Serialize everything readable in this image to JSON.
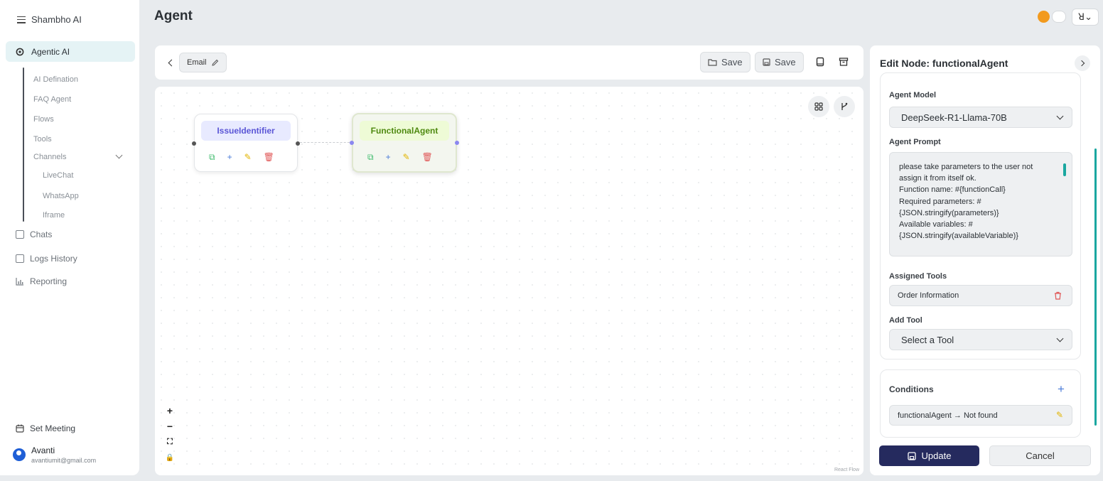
{
  "sidebar": {
    "brand": "Shambho AI",
    "active_item": "Agentic AI",
    "sub_items": [
      "AI Defination",
      "FAQ Agent",
      "Flows",
      "Tools",
      "Channels"
    ],
    "channel_items": [
      "LiveChat",
      "WhatsApp",
      "Iframe"
    ],
    "nav_items": [
      "Chats",
      "Logs History",
      "Reporting"
    ],
    "set_meeting": "Set Meeting",
    "user": {
      "name": "Avanti",
      "email": "avantiumit@gmail.com"
    }
  },
  "header": {
    "title": "Agent",
    "user_glyph": "ꓤ⌄"
  },
  "toolbar": {
    "tag": "Email",
    "save_draft": "Save",
    "save": "Save"
  },
  "canvas": {
    "nodes": [
      {
        "label": "IssueIdentifier"
      },
      {
        "label": "FunctionalAgent"
      }
    ],
    "zoom_in": "+",
    "zoom_out": "−",
    "fit": "⛶",
    "lock": "🔒",
    "attribution": "React Flow"
  },
  "panel": {
    "title": "Edit Node: functionalAgent",
    "agent_model_label": "Agent Model",
    "agent_model_value": "DeepSeek-R1-Llama-70B",
    "agent_prompt_label": "Agent Prompt",
    "agent_prompt": "please take parameters to the user not assign it from itself ok.\nFunction name: #{functionCall}\nRequired parameters: #{JSON.stringify(parameters)}\nAvailable variables: #{JSON.stringify(availableVariable)}",
    "assigned_tools_label": "Assigned Tools",
    "assigned_tool": "Order Information",
    "add_tool_label": "Add Tool",
    "add_tool_placeholder": "Select a Tool",
    "conditions_label": "Conditions",
    "condition": "functionalAgent → Not found",
    "update": "Update",
    "cancel": "Cancel"
  },
  "colors": {
    "accent_teal": "#1aa7a0",
    "primary_navy": "#252a5e",
    "node1_label_bg": "#e8eaff",
    "node1_label_text": "#5a55d6",
    "node2_label_bg": "#eefbd6",
    "node2_label_text": "#4f8a10",
    "danger": "#e05656"
  }
}
